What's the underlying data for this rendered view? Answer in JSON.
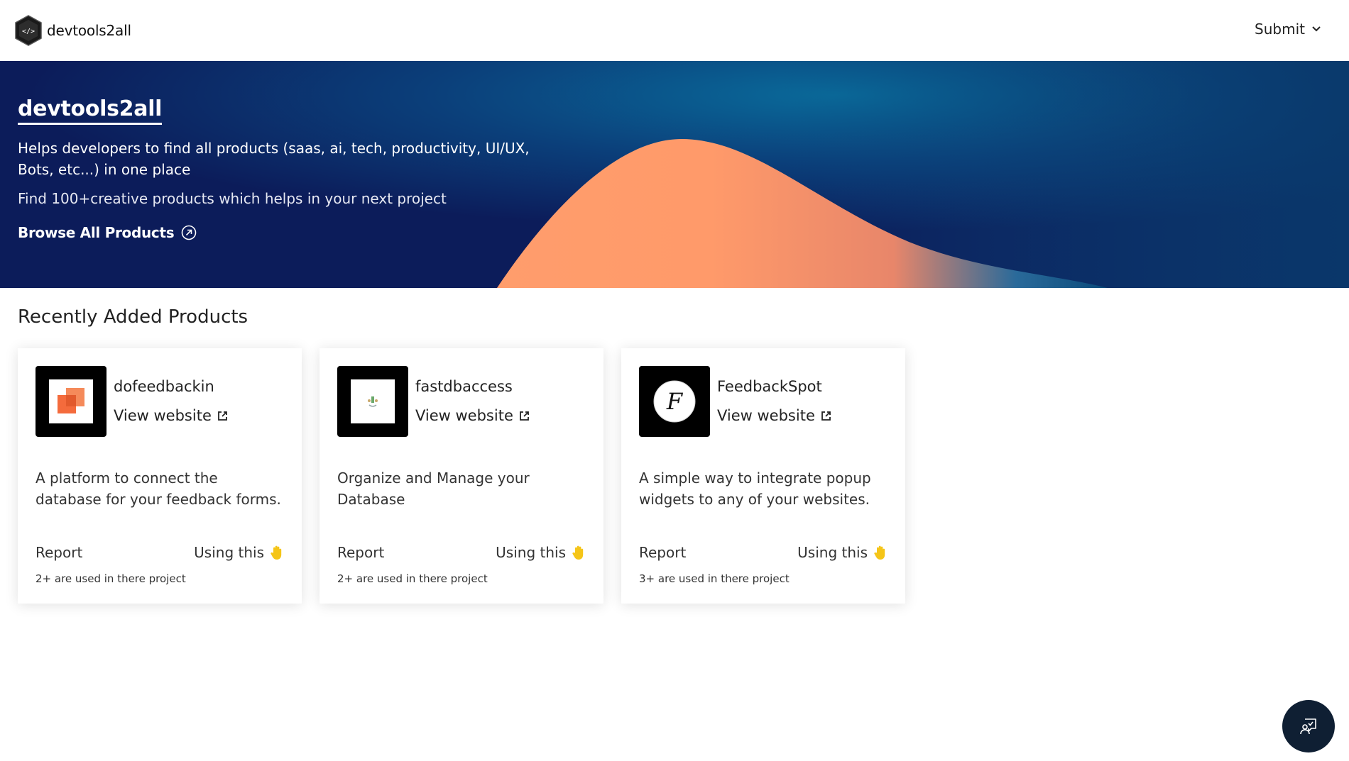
{
  "header": {
    "brand_name": "devtools2all",
    "submit_label": "Submit"
  },
  "hero": {
    "title": "devtools2all",
    "description": "Helps developers to find all products (saas, ai, tech, productivity, UI/UX, Bots, etc...) in one place",
    "subtitle": "Find 100+creative products which helps in your next project",
    "cta_label": "Browse All Products"
  },
  "section": {
    "title": "Recently Added Products"
  },
  "products": [
    {
      "name": "dofeedbackin",
      "link_label": "View website",
      "description": "A platform to connect the database for your feedback forms.",
      "report_label": "Report",
      "using_label": "Using this",
      "usage_count": "2+ are used in there project"
    },
    {
      "name": "fastdbaccess",
      "link_label": "View website",
      "description": "Organize and Manage your Database",
      "report_label": "Report",
      "using_label": "Using this",
      "usage_count": "2+ are used in there project"
    },
    {
      "name": "FeedbackSpot",
      "link_label": "View website",
      "description": "A simple way to integrate popup widgets to any of your websites.",
      "report_label": "Report",
      "using_label": "Using this",
      "usage_count": "3+ are used in there project"
    }
  ],
  "colors": {
    "hero_navy": "#0c1c5a",
    "hero_orange": "#ff9a6a",
    "accent_hand": "#f5c518",
    "fab_bg": "#0f1f33"
  },
  "icons": {
    "brand": "code-hexagon-icon",
    "submit_chevron": "chevron-down-icon",
    "cta": "arrow-up-right-circle-icon",
    "external_link": "external-link-icon",
    "using": "raised-hand-icon",
    "fab": "chat-support-icon"
  }
}
